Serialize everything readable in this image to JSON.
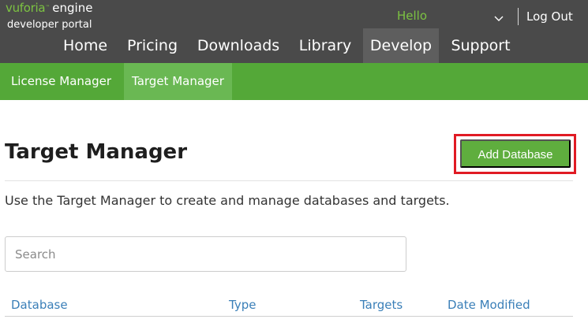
{
  "header": {
    "logo": {
      "brand": "vuforia",
      "trademark": "™",
      "product": "engine",
      "subtitle": "developer portal"
    },
    "greeting": "Hello",
    "logout_label": "Log Out",
    "nav": [
      {
        "label": "Home",
        "active": false
      },
      {
        "label": "Pricing",
        "active": false
      },
      {
        "label": "Downloads",
        "active": false
      },
      {
        "label": "Library",
        "active": false
      },
      {
        "label": "Develop",
        "active": true
      },
      {
        "label": "Support",
        "active": false
      }
    ]
  },
  "subnav": [
    {
      "label": "License Manager",
      "active": false
    },
    {
      "label": "Target Manager",
      "active": true
    }
  ],
  "main": {
    "title": "Target Manager",
    "add_button_label": "Add Database",
    "description": "Use the Target Manager to create and manage databases and targets.",
    "search_placeholder": "Search",
    "search_value": "",
    "table": {
      "columns": [
        "Database",
        "Type",
        "Targets",
        "Date Modified"
      ],
      "rows": []
    }
  },
  "colors": {
    "topbar_bg": "#4a4a4a",
    "nav_active_bg": "#5e5e5e",
    "subnav_bg": "#54a838",
    "subnav_active_bg": "#6ab853",
    "brand_green": "#7cc242",
    "button_green": "#5fae3e",
    "highlight_red": "#e01b24",
    "link_blue": "#3a7fb8"
  },
  "icons": {
    "user_menu": "chevron-down-icon"
  }
}
